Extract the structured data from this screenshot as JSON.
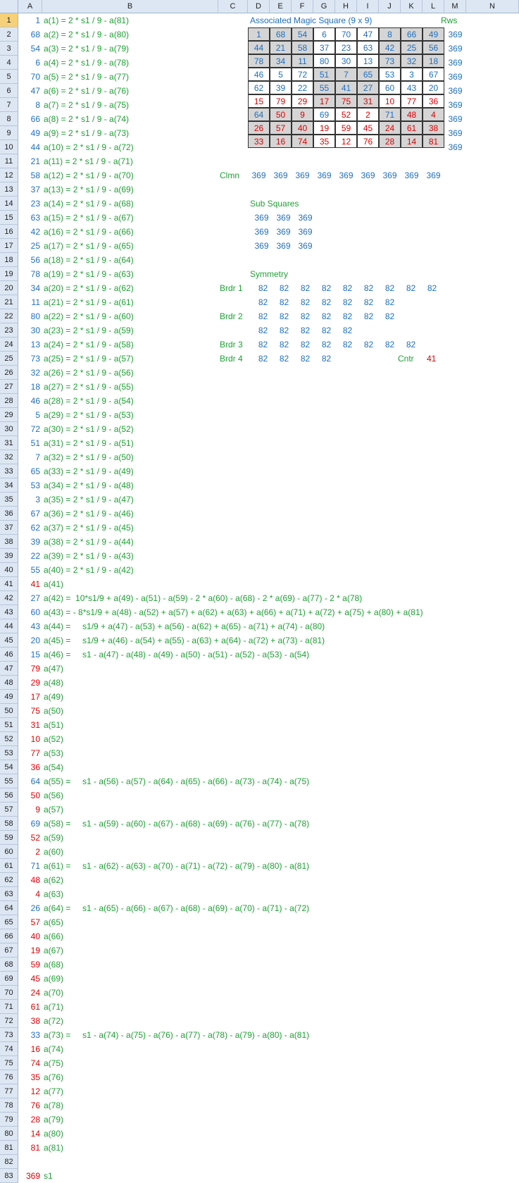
{
  "columns": [
    "A",
    "B",
    "C",
    "D",
    "E",
    "F",
    "G",
    "H",
    "I",
    "J",
    "K",
    "L",
    "M",
    "N"
  ],
  "rows_count": 83,
  "colA": {
    "1": "1",
    "2": "68",
    "3": "54",
    "4": "6",
    "5": "70",
    "6": "47",
    "7": "8",
    "8": "66",
    "9": "49",
    "10": "44",
    "11": "21",
    "12": "58",
    "13": "37",
    "14": "23",
    "15": "63",
    "16": "42",
    "17": "25",
    "18": "56",
    "19": "78",
    "20": "34",
    "21": "11",
    "22": "80",
    "23": "30",
    "24": "13",
    "25": "73",
    "26": "32",
    "27": "18",
    "28": "46",
    "29": "5",
    "30": "72",
    "31": "51",
    "32": "7",
    "33": "65",
    "34": "53",
    "35": "3",
    "36": "67",
    "37": "62",
    "38": "39",
    "39": "22",
    "40": "55",
    "41": "41",
    "42": "27",
    "43": "60",
    "44": "43",
    "45": "20",
    "46": "15",
    "47": "79",
    "48": "29",
    "49": "17",
    "50": "75",
    "51": "31",
    "52": "10",
    "53": "77",
    "54": "36",
    "55": "64",
    "56": "50",
    "57": "9",
    "58": "69",
    "59": "52",
    "60": "2",
    "61": "71",
    "62": "48",
    "63": "4",
    "64": "26",
    "65": "57",
    "66": "40",
    "67": "19",
    "68": "59",
    "69": "45",
    "70": "24",
    "71": "61",
    "72": "38",
    "73": "33",
    "74": "16",
    "75": "74",
    "76": "35",
    "77": "12",
    "78": "76",
    "79": "28",
    "80": "14",
    "81": "81",
    "83": "369"
  },
  "colA_red_rows": [
    41,
    47,
    48,
    49,
    50,
    51,
    52,
    53,
    54,
    56,
    57,
    59,
    60,
    62,
    63,
    65,
    66,
    67,
    68,
    69,
    70,
    71,
    72,
    74,
    75,
    76,
    77,
    78,
    79,
    80,
    81,
    83
  ],
  "colB": {
    "1": "a(1) = 2 * s1 / 9 - a(81)",
    "2": "a(2) = 2 * s1 / 9 - a(80)",
    "3": "a(3) = 2 * s1 / 9 - a(79)",
    "4": "a(4) = 2 * s1 / 9 - a(78)",
    "5": "a(5) = 2 * s1 / 9 - a(77)",
    "6": "a(6) = 2 * s1 / 9 - a(76)",
    "7": "a(7) = 2 * s1 / 9 - a(75)",
    "8": "a(8) = 2 * s1 / 9 - a(74)",
    "9": "a(9) = 2 * s1 / 9 - a(73)",
    "10": "a(10) = 2 * s1 / 9 - a(72)",
    "11": "a(11) = 2 * s1 / 9 - a(71)",
    "12": "a(12) = 2 * s1 / 9 - a(70)",
    "13": "a(13) = 2 * s1 / 9 - a(69)",
    "14": "a(14) = 2 * s1 / 9 - a(68)",
    "15": "a(15) = 2 * s1 / 9 - a(67)",
    "16": "a(16) = 2 * s1 / 9 - a(66)",
    "17": "a(17) = 2 * s1 / 9 - a(65)",
    "18": "a(18) = 2 * s1 / 9 - a(64)",
    "19": "a(19) = 2 * s1 / 9 - a(63)",
    "20": "a(20) = 2 * s1 / 9 - a(62)",
    "21": "a(21) = 2 * s1 / 9 - a(61)",
    "22": "a(22) = 2 * s1 / 9 - a(60)",
    "23": "a(23) = 2 * s1 / 9 - a(59)",
    "24": "a(24) = 2 * s1 / 9 - a(58)",
    "25": "a(25) = 2 * s1 / 9 - a(57)",
    "26": "a(26) = 2 * s1 / 9 - a(56)",
    "27": "a(27) = 2 * s1 / 9 - a(55)",
    "28": "a(28) = 2 * s1 / 9 - a(54)",
    "29": "a(29) = 2 * s1 / 9 - a(53)",
    "30": "a(30) = 2 * s1 / 9 - a(52)",
    "31": "a(31) = 2 * s1 / 9 - a(51)",
    "32": "a(32) = 2 * s1 / 9 - a(50)",
    "33": "a(33) = 2 * s1 / 9 - a(49)",
    "34": "a(34) = 2 * s1 / 9 - a(48)",
    "35": "a(35) = 2 * s1 / 9 - a(47)",
    "36": "a(36) = 2 * s1 / 9 - a(46)",
    "37": "a(37) = 2 * s1 / 9 - a(45)",
    "38": "a(38) = 2 * s1 / 9 - a(44)",
    "39": "a(39) = 2 * s1 / 9 - a(43)",
    "40": "a(40) = 2 * s1 / 9 - a(42)",
    "41": "a(41)",
    "42": "a(42) =  10*s1/9 + a(49) - a(51) - a(59) - 2 * a(60) - a(68) - 2 * a(69) - a(77) - 2 * a(78)",
    "43": "a(43) = - 8*s1/9 + a(48) - a(52) + a(57) + a(62) + a(63) + a(66) + a(71) + a(72) + a(75) + a(80) + a(81)",
    "44": "a(44) =     s1/9 + a(47) - a(53) + a(56) - a(62) + a(65) - a(71) + a(74) - a(80)",
    "45": "a(45) =     s1/9 + a(46) - a(54) + a(55) - a(63) + a(64) - a(72) + a(73) - a(81)",
    "46": "a(46) =     s1 - a(47) - a(48) - a(49) - a(50) - a(51) - a(52) - a(53) - a(54)",
    "47": "a(47)",
    "48": "a(48)",
    "49": "a(49)",
    "50": "a(50)",
    "51": "a(51)",
    "52": "a(52)",
    "53": "a(53)",
    "54": "a(54)",
    "55": "a(55) =     s1 - a(56) - a(57) - a(64) - a(65) - a(66) - a(73) - a(74) - a(75)",
    "56": "a(56)",
    "57": "a(57)",
    "58": "a(58) =     s1 - a(59) - a(60) - a(67) - a(68) - a(69) - a(76) - a(77) - a(78)",
    "59": "a(59)",
    "60": "a(60)",
    "61": "a(61) =     s1 - a(62) - a(63) - a(70) - a(71) - a(72) - a(79) - a(80) - a(81)",
    "62": "a(62)",
    "63": "a(63)",
    "64": "a(64) =     s1 - a(65) - a(66) - a(67) - a(68) - a(69) - a(70) - a(71) - a(72)",
    "65": "a(65)",
    "66": "a(66)",
    "67": "a(67)",
    "68": "a(68)",
    "69": "a(69)",
    "70": "a(70)",
    "71": "a(71)",
    "72": "a(72)",
    "73": "a(73) =     s1 - a(74) - a(75) - a(76) - a(77) - a(78) - a(79) - a(80) - a(81)",
    "74": "a(74)",
    "75": "a(75)",
    "76": "a(76)",
    "77": "a(77)",
    "78": "a(78)",
    "79": "a(79)",
    "80": "a(80)",
    "81": "a(81)",
    "83": "s1"
  },
  "square": {
    "title": "Associated Magic Square (9 x 9)",
    "rws_label": "Rws",
    "values": [
      [
        "1",
        "68",
        "54",
        "6",
        "70",
        "47",
        "8",
        "66",
        "49"
      ],
      [
        "44",
        "21",
        "58",
        "37",
        "23",
        "63",
        "42",
        "25",
        "56"
      ],
      [
        "78",
        "34",
        "11",
        "80",
        "30",
        "13",
        "73",
        "32",
        "18"
      ],
      [
        "46",
        "5",
        "72",
        "51",
        "7",
        "65",
        "53",
        "3",
        "67"
      ],
      [
        "62",
        "39",
        "22",
        "55",
        "41",
        "27",
        "60",
        "43",
        "20"
      ],
      [
        "15",
        "79",
        "29",
        "17",
        "75",
        "31",
        "10",
        "77",
        "36"
      ],
      [
        "64",
        "50",
        "9",
        "69",
        "52",
        "2",
        "71",
        "48",
        "4"
      ],
      [
        "26",
        "57",
        "40",
        "19",
        "59",
        "45",
        "24",
        "61",
        "38"
      ],
      [
        "33",
        "16",
        "74",
        "35",
        "12",
        "76",
        "28",
        "14",
        "81"
      ]
    ],
    "shaded": [
      [
        1,
        1,
        1,
        0,
        0,
        0,
        1,
        1,
        1
      ],
      [
        1,
        1,
        1,
        0,
        0,
        0,
        1,
        1,
        1
      ],
      [
        1,
        1,
        1,
        0,
        0,
        0,
        1,
        1,
        1
      ],
      [
        0,
        0,
        0,
        1,
        1,
        1,
        0,
        0,
        0
      ],
      [
        0,
        0,
        0,
        1,
        1,
        1,
        0,
        0,
        0
      ],
      [
        0,
        0,
        0,
        1,
        1,
        1,
        0,
        0,
        0
      ],
      [
        1,
        1,
        1,
        0,
        0,
        0,
        1,
        1,
        1
      ],
      [
        1,
        1,
        1,
        0,
        0,
        0,
        1,
        1,
        1
      ],
      [
        1,
        1,
        1,
        0,
        0,
        0,
        1,
        1,
        1
      ]
    ],
    "red_from_row": 5,
    "row_sums": [
      "369",
      "369",
      "369",
      "369",
      "369",
      "369",
      "369",
      "369",
      "369"
    ]
  },
  "clmn": {
    "label": "Clmn",
    "values": [
      "369",
      "369",
      "369",
      "369",
      "369",
      "369",
      "369",
      "369",
      "369"
    ]
  },
  "sub_squares": {
    "title": "Sub Squares",
    "rows": [
      [
        "369",
        "369",
        "369"
      ],
      [
        "369",
        "369",
        "369"
      ],
      [
        "369",
        "369",
        "369"
      ]
    ]
  },
  "symmetry": {
    "title": "Symmetry",
    "rows": [
      {
        "label": "Brdr 1",
        "values": [
          "82",
          "82",
          "82",
          "82",
          "82",
          "82",
          "82",
          "82",
          "82"
        ]
      },
      {
        "label": "",
        "values": [
          "82",
          "82",
          "82",
          "82",
          "82",
          "82",
          "82"
        ]
      },
      {
        "label": "Brdr 2",
        "values": [
          "82",
          "82",
          "82",
          "82",
          "82",
          "82",
          "82"
        ]
      },
      {
        "label": "",
        "values": [
          "82",
          "82",
          "82",
          "82",
          "82"
        ]
      },
      {
        "label": "Brdr 3",
        "values": [
          "82",
          "82",
          "82",
          "82",
          "82",
          "82",
          "82",
          "82"
        ]
      },
      {
        "label": "Brdr 4",
        "values": [
          "82",
          "82",
          "82",
          "82"
        ]
      }
    ],
    "cntr_label": "Cntr",
    "cntr_value": "41"
  },
  "colors": {
    "blue": "#1f6fbf",
    "red": "#e00000",
    "green": "#1fa035",
    "header_bg": "#dde7f3",
    "selected_header": "#f6d17a",
    "shade": "#d5d5d5"
  }
}
